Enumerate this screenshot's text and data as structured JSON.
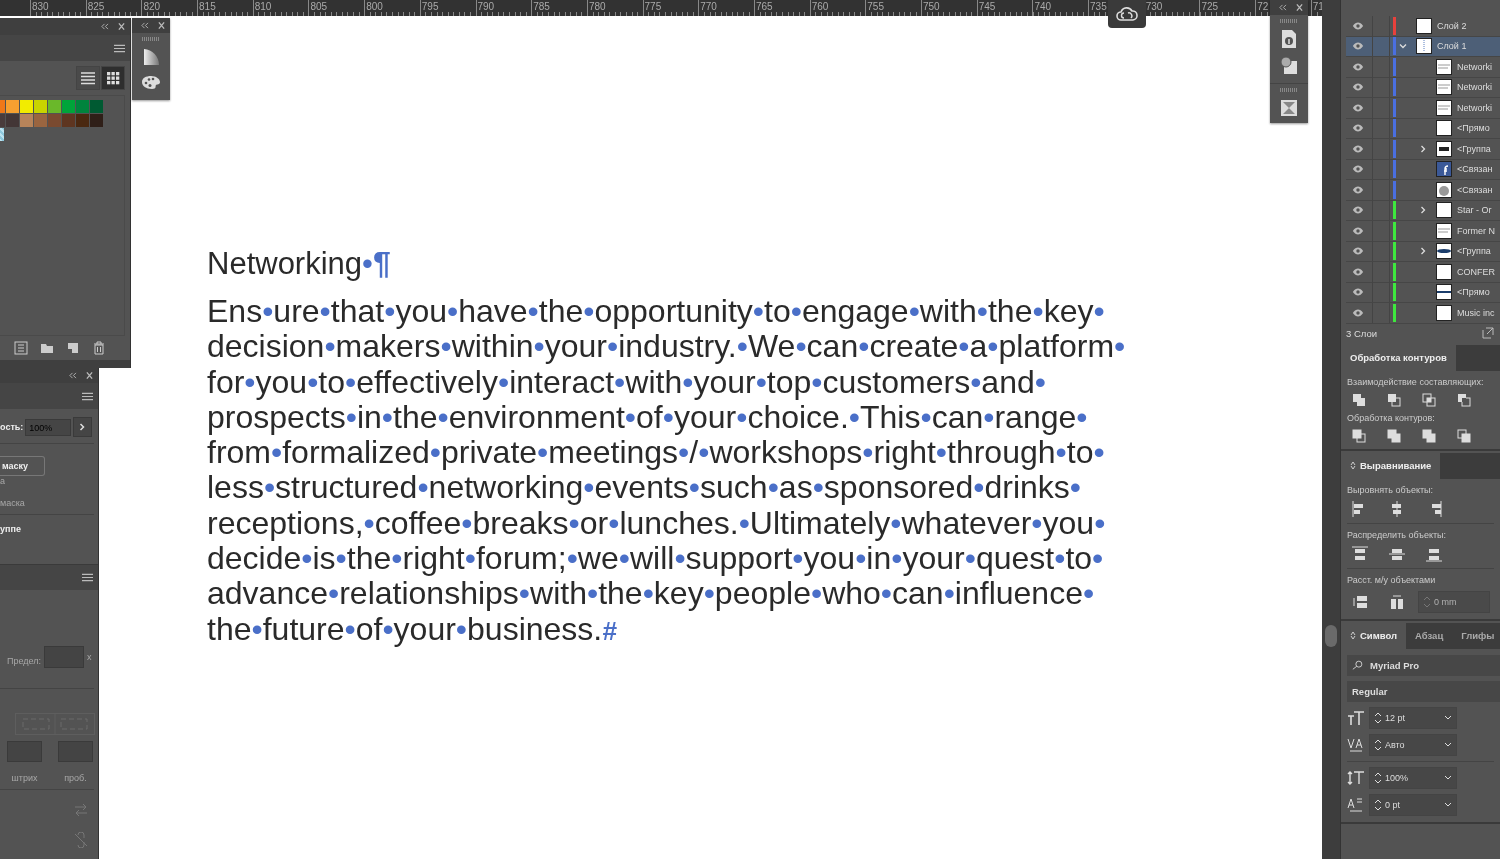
{
  "ruler": {
    "labels": [
      "830",
      "825",
      "820",
      "815",
      "810",
      "805",
      "800",
      "795",
      "790",
      "785",
      "780",
      "775",
      "770",
      "765",
      "760",
      "755",
      "750",
      "745",
      "740",
      "735",
      "730",
      "725",
      "72",
      "71"
    ]
  },
  "document": {
    "heading": "Networking•",
    "heading_end": "¶",
    "end_mark": "#",
    "lines": [
      "Ens•ure•that•you•have•the•opportunity•to•engage•with•the•key•",
      "decision•makers•within•your•industry.•We•can•create•a•platform•",
      "for•you•to•effectively•interact•with•your•top•customers•and•",
      "prospects•in•the•environment•of•your•choice.•This•can•range•",
      "from•formalized•private•meetings•/•workshops•right•through•to•",
      "less•structured•networking•events•such•as•sponsored•drinks•",
      "receptions,•coffee•breaks•or•lunches.•Ultimately•whatever•you•",
      "decide•is•the•right•forum;•we•will•support•you•in•your•quest•to•",
      "advance•relationships•with•the•key•people•who•can•influence•",
      "the•future•of•your•business."
    ]
  },
  "swatches_panel": {
    "views": [
      {
        "kind": "list",
        "selected": false
      },
      {
        "kind": "grid",
        "selected": true
      }
    ],
    "swatches": [
      {
        "color": "#f07818"
      },
      {
        "color": "#f7a030"
      },
      {
        "color": "#f2ec00"
      },
      {
        "color": "#c8d400"
      },
      {
        "color": "#6ab82a"
      },
      {
        "color": "#00a43a"
      },
      {
        "color": "#00843d"
      },
      {
        "color": "#005a32"
      },
      {
        "color": "#4a3c3c"
      },
      {
        "color": "#433636"
      },
      {
        "color": "#b7845a"
      },
      {
        "color": "#9a6540"
      },
      {
        "color": "#7a4a30"
      },
      {
        "color": "#5e3520"
      },
      {
        "color": "#4a2810"
      },
      {
        "color": "#2f1f18"
      }
    ]
  },
  "transparency_panel": {
    "opacity_label": "ость:",
    "opacity": "100%",
    "mask_button": "маску",
    "option_1": "а",
    "option_2": "маска",
    "group_option": "уппе"
  },
  "stroke_panel": {
    "limit_label": "Предел:",
    "limit_unit": "x",
    "stroke_label": "штрих",
    "gap_label": "проб."
  },
  "layers": {
    "items": [
      {
        "name": "Слой 2",
        "color": "#e8413c",
        "selected": false,
        "expandable": false,
        "kind": "blank"
      },
      {
        "name": "Слой 1",
        "color": "#4a6fe0",
        "selected": true,
        "expanded": true,
        "expandable": true,
        "kind": "lines",
        "children": [
          {
            "name": "Networki",
            "color": "#4a6fe0",
            "selected": false,
            "expandable": false,
            "kind": "text"
          },
          {
            "name": "Networki",
            "color": "#4a6fe0",
            "selected": false,
            "expandable": false,
            "kind": "text"
          },
          {
            "name": "Networki",
            "color": "#4a6fe0",
            "selected": false,
            "expandable": false,
            "kind": "text"
          },
          {
            "name": "<Прямо",
            "color": "#4a6fe0",
            "selected": false,
            "expandable": false,
            "kind": "blank"
          },
          {
            "name": "<Группа",
            "color": "#4a6fe0",
            "selected": false,
            "expandable": true,
            "expanded": false,
            "kind": "badge"
          },
          {
            "name": "<Связан",
            "color": "#4a6fe0",
            "selected": false,
            "expandable": false,
            "kind": "blue"
          },
          {
            "name": "<Связан",
            "color": "#4a6fe0",
            "selected": false,
            "expandable": false,
            "kind": "blob"
          },
          {
            "name": "Star - Or",
            "color": "#3ee83e",
            "selected": false,
            "expandable": true,
            "expanded": false,
            "kind": "blank"
          },
          {
            "name": "Former N",
            "color": "#3ee83e",
            "selected": false,
            "expandable": false,
            "kind": "text"
          },
          {
            "name": "<Группа",
            "color": "#3ee83e",
            "selected": false,
            "expandable": true,
            "expanded": false,
            "kind": "band"
          },
          {
            "name": "CONFER",
            "color": "#3ee83e",
            "selected": false,
            "expandable": false,
            "kind": "blank"
          },
          {
            "name": "<Прямо",
            "color": "#3ee83e",
            "selected": false,
            "expandable": false,
            "kind": "rule"
          },
          {
            "name": "Music inc",
            "color": "#3ee83e",
            "selected": false,
            "expandable": false,
            "kind": "blank"
          }
        ]
      }
    ],
    "count": "3 Слои"
  },
  "pathfinder": {
    "tab": "Обработка контуров",
    "shape_modes_label": "Взаимодействие составляющих:",
    "pathfinders_label": "Обработка контуров:"
  },
  "align": {
    "tab": "Выравнивание",
    "align_label": "Выровнять объекты:",
    "distribute_label": "Распределить объекты:",
    "spacing_label": "Расст. м/у объектами",
    "spacing": {
      "value": "0 mm",
      "disabled": true
    }
  },
  "character": {
    "tabs": [
      {
        "label": "Символ",
        "selected": true
      },
      {
        "label": "Абзац",
        "selected": false
      },
      {
        "label": "Глифы",
        "selected": false
      }
    ],
    "font": "Myriad Pro",
    "style": "Regular",
    "rows": [
      {
        "kind": "size",
        "value": "12 pt"
      },
      {
        "kind": "tracking",
        "value": "Авто"
      },
      {
        "kind": "scale",
        "value": "100%"
      },
      {
        "kind": "baseline",
        "value": "0 pt"
      }
    ]
  }
}
